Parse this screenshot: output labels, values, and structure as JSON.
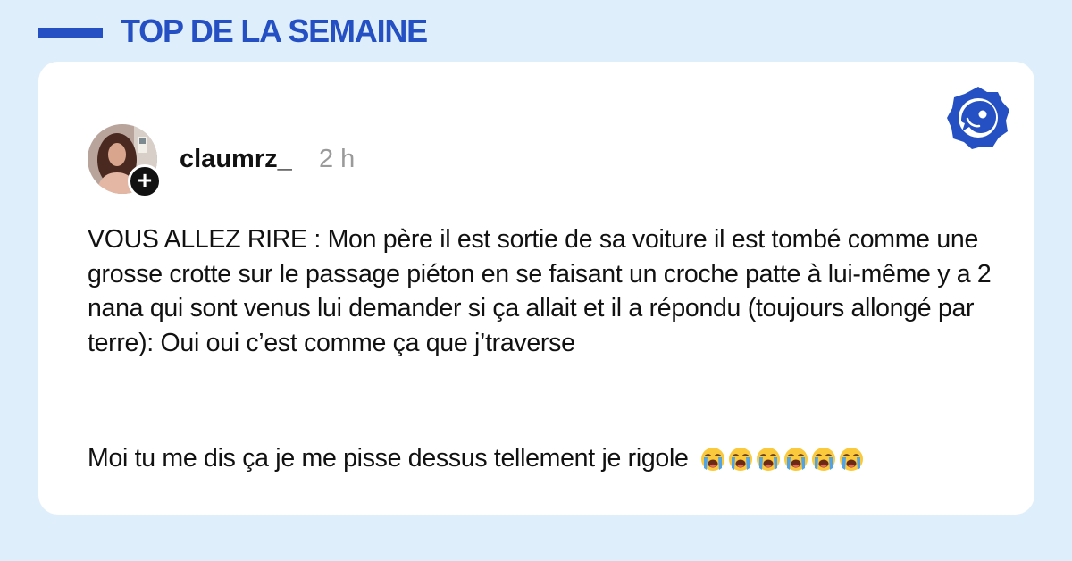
{
  "header": {
    "title": "TOP DE LA SEMAINE"
  },
  "colors": {
    "background": "#dfeefb",
    "accent": "#2450c4",
    "card": "#ffffff",
    "text": "#111111",
    "muted": "#9a9a9a"
  },
  "post": {
    "username": "claumrz_",
    "time": "2 h",
    "follow_icon": "plus-icon",
    "paragraph_1": "VOUS ALLEZ RIRE : Mon père il est sortie de sa voiture il est tombé comme une grosse crotte sur le passage piéton en se faisant un croche patte à lui-même y a 2 nana qui sont venus lui demander si ça allait et il a répondu (toujours allongé par terre): Oui oui c’est comme ça que j’traverse",
    "paragraph_2": "Moi tu me dis ça je me pisse dessus tellement je rigole",
    "emoji_name": "loudly-crying-face-icon",
    "emoji_count": 6
  },
  "brand": {
    "logo_icon": "brand-badge-icon"
  }
}
